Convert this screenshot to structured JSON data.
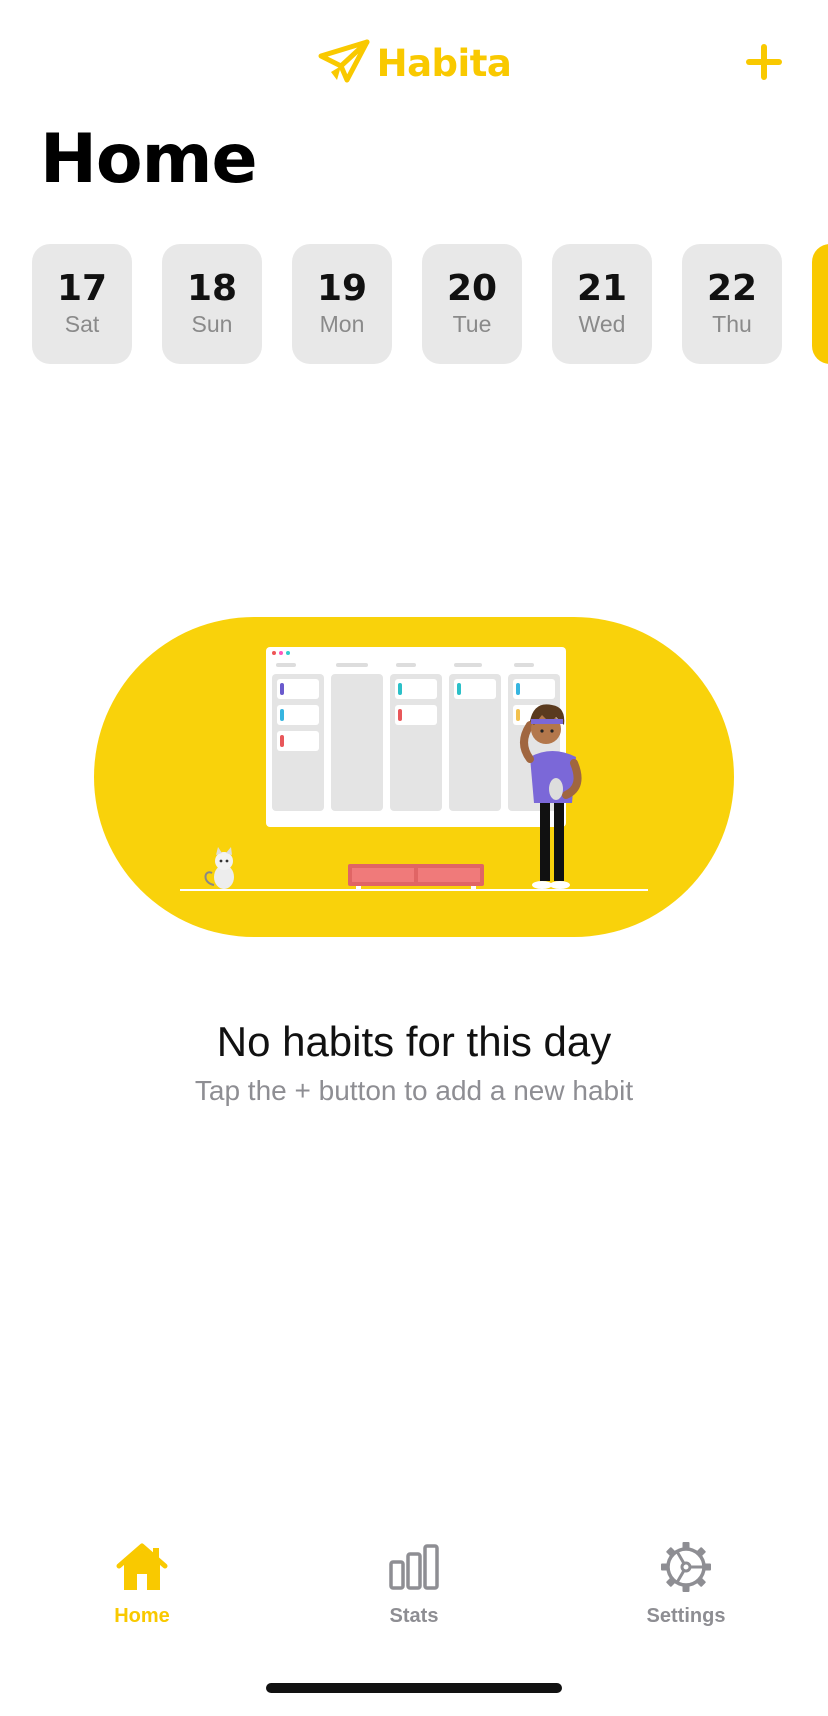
{
  "app": {
    "name": "Habita",
    "logo_icon": "paper-plane-icon",
    "accent_color": "#F9C900"
  },
  "header": {
    "add_icon": "plus-icon"
  },
  "page": {
    "title": "Home"
  },
  "dates": [
    {
      "num": "17",
      "day": "Sat",
      "selected": false
    },
    {
      "num": "18",
      "day": "Sun",
      "selected": false
    },
    {
      "num": "19",
      "day": "Mon",
      "selected": false
    },
    {
      "num": "20",
      "day": "Tue",
      "selected": false
    },
    {
      "num": "21",
      "day": "Wed",
      "selected": false
    },
    {
      "num": "22",
      "day": "Thu",
      "selected": false
    },
    {
      "num": "",
      "day": "",
      "selected": true
    }
  ],
  "empty_state": {
    "title": "No habits for this day",
    "subtitle": "Tap the + button to add a new habit",
    "illustration": "kanban-board-person-cat-illustration"
  },
  "tabs": [
    {
      "label": "Home",
      "icon": "house-icon",
      "active": true
    },
    {
      "label": "Stats",
      "icon": "bar-chart-icon",
      "active": false
    },
    {
      "label": "Settings",
      "icon": "gear-icon",
      "active": false
    }
  ]
}
